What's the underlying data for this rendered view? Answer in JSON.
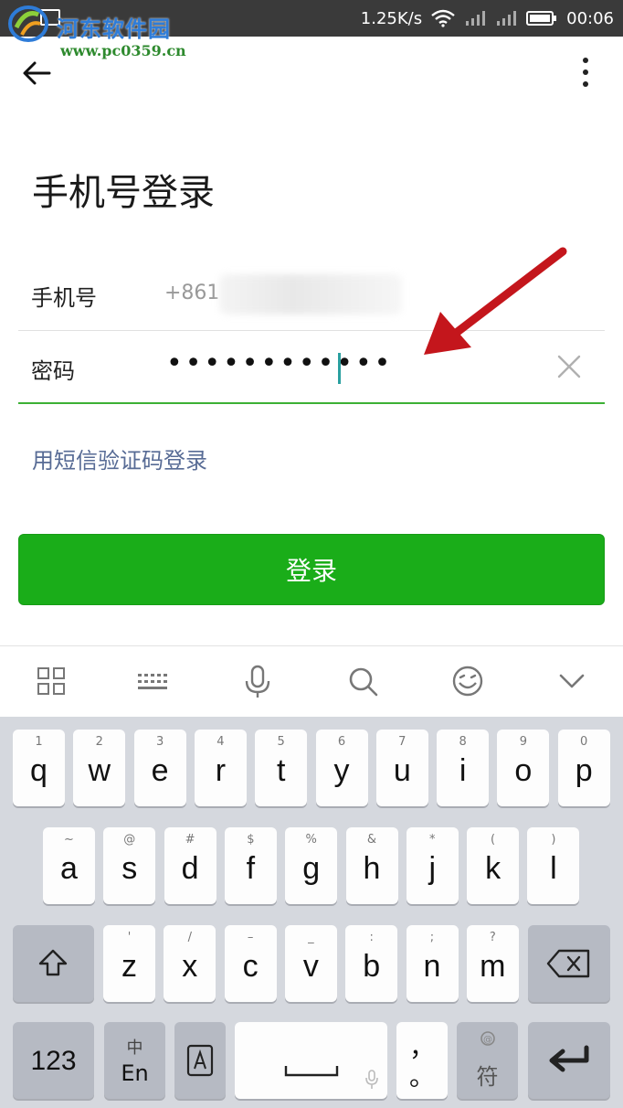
{
  "status_bar": {
    "watermark_title": "河东软件园",
    "watermark_url": "www.pc0359.cn",
    "net_speed": "1.25K/s",
    "time": "00:06"
  },
  "page": {
    "title": "手机号登录",
    "phone_label": "手机号",
    "phone_value": "+861",
    "password_label": "密码",
    "password_value": "••••••••••••",
    "sms_login_link": "用短信验证码登录",
    "login_button": "登录"
  },
  "keyboard": {
    "toolbar_icons": [
      "grid-icon",
      "keyboard-icon",
      "microphone-icon",
      "search-icon",
      "emoji-icon",
      "chevron-down-icon"
    ],
    "row1": [
      {
        "hint": "1",
        "key": "q"
      },
      {
        "hint": "2",
        "key": "w"
      },
      {
        "hint": "3",
        "key": "e"
      },
      {
        "hint": "4",
        "key": "r"
      },
      {
        "hint": "5",
        "key": "t"
      },
      {
        "hint": "6",
        "key": "y"
      },
      {
        "hint": "7",
        "key": "u"
      },
      {
        "hint": "8",
        "key": "i"
      },
      {
        "hint": "9",
        "key": "o"
      },
      {
        "hint": "0",
        "key": "p"
      }
    ],
    "row2": [
      {
        "hint": "~",
        "key": "a"
      },
      {
        "hint": "@",
        "key": "s"
      },
      {
        "hint": "#",
        "key": "d"
      },
      {
        "hint": "$",
        "key": "f"
      },
      {
        "hint": "%",
        "key": "g"
      },
      {
        "hint": "&",
        "key": "h"
      },
      {
        "hint": "*",
        "key": "j"
      },
      {
        "hint": "(",
        "key": "k"
      },
      {
        "hint": ")",
        "key": "l"
      }
    ],
    "row3": [
      {
        "hint": "'",
        "key": "z"
      },
      {
        "hint": "/",
        "key": "x"
      },
      {
        "hint": "–",
        "key": "c"
      },
      {
        "hint": "_",
        "key": "v"
      },
      {
        "hint": ":",
        "key": "b"
      },
      {
        "hint": ";",
        "key": "n"
      },
      {
        "hint": "?",
        "key": "m"
      }
    ],
    "num_key": "123",
    "lang_key_top": "中",
    "lang_key_bottom": "En",
    "punct_top": "，",
    "punct_bottom": "。",
    "symbol_key": "符"
  },
  "colors": {
    "accent_green": "#1aad19",
    "link_blue": "#576b95",
    "annotation_red": "#c4161c"
  }
}
